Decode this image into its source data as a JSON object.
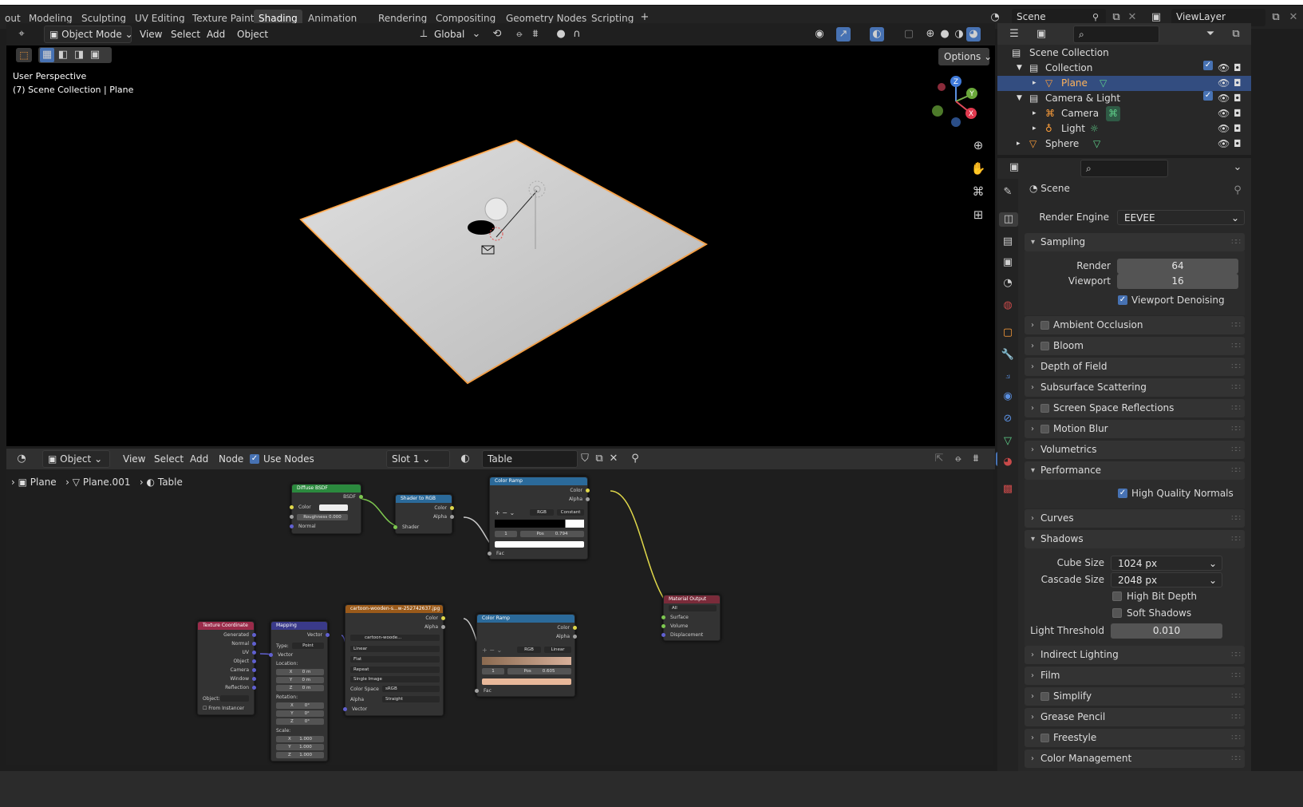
{
  "workspace_tabs": [
    "out",
    "Modeling",
    "Sculpting",
    "UV Editing",
    "Texture Paint",
    "Shading",
    "Animation",
    "Rendering",
    "Compositing",
    "Geometry Nodes",
    "Scripting"
  ],
  "active_tab": "Shading",
  "scene_name": "Scene",
  "view_layer": "ViewLayer",
  "viewport": {
    "mode": "Object Mode",
    "menus": [
      "View",
      "Select",
      "Add",
      "Object"
    ],
    "transform_orientation": "Global",
    "options_label": "Options",
    "overlay_line1": "User Perspective",
    "overlay_line2": "(7) Scene Collection | Plane",
    "gizmo_axes": {
      "z": "Z",
      "y": "Y",
      "x": "X"
    }
  },
  "node_editor": {
    "editor_type": "Object",
    "menus": [
      "View",
      "Select",
      "Add",
      "Node"
    ],
    "use_nodes_label": "Use Nodes",
    "slot": "Slot 1",
    "material": "Table",
    "breadcrumb": [
      "Plane",
      "Plane.001",
      "Table"
    ],
    "nodes": {
      "diffuse": {
        "title": "Diffuse BSDF",
        "out": "BSDF",
        "color": "Color",
        "roughness": "Roughness",
        "roughness_val": "0.000",
        "normal": "Normal"
      },
      "shader_rgb": {
        "title": "Shader to RGB",
        "color": "Color",
        "alpha": "Alpha",
        "shader": "Shader"
      },
      "ramp1": {
        "title": "Color Ramp",
        "color": "Color",
        "alpha": "Alpha",
        "mode": "RGB",
        "interp": "Constant",
        "idx": "1",
        "pos_label": "Pos",
        "pos": "0.794",
        "fac": "Fac"
      },
      "ramp2": {
        "title": "Color Ramp",
        "color": "Color",
        "alpha": "Alpha",
        "mode": "RGB",
        "interp": "Linear",
        "idx": "1",
        "pos_label": "Pos",
        "pos": "0.605",
        "fac": "Fac"
      },
      "output": {
        "title": "Material Output",
        "target": "All",
        "surface": "Surface",
        "volume": "Volume",
        "displacement": "Displacement"
      },
      "texcoord": {
        "title": "Texture Coordinate",
        "outs": [
          "Generated",
          "Normal",
          "UV",
          "Object",
          "Camera",
          "Window",
          "Reflection"
        ],
        "object_label": "Object:",
        "from_instancer": "From Instancer"
      },
      "mapping": {
        "title": "Mapping",
        "vector_out": "Vector",
        "type_label": "Type:",
        "type": "Point",
        "vector_in": "Vector",
        "location": "Location:",
        "rotation": "Rotation:",
        "scale": "Scale:",
        "loc": [
          "0 m",
          "0 m",
          "0 m"
        ],
        "rot": [
          "0°",
          "0°",
          "0°"
        ],
        "scl": [
          "1.000",
          "1.000",
          "1.000"
        ],
        "axes": [
          "X",
          "Y",
          "Z"
        ]
      },
      "image": {
        "title": "cartoon-wooden-s...w-252742637.jpg",
        "color": "Color",
        "alpha": "Alpha",
        "file": "cartoon-woode...",
        "interp": "Linear",
        "proj": "Flat",
        "ext": "Repeat",
        "src": "Single Image",
        "cs_label": "Color Space",
        "cs": "sRGB",
        "alpha_label": "Alpha",
        "alpha_mode": "Straight",
        "vector": "Vector"
      }
    }
  },
  "outliner": {
    "rows": [
      {
        "label": "Scene Collection",
        "indent": 0
      },
      {
        "label": "Collection",
        "indent": 1
      },
      {
        "label": "Plane",
        "indent": 2,
        "selected": true
      },
      {
        "label": "Camera & Light",
        "indent": 1
      },
      {
        "label": "Camera",
        "indent": 2
      },
      {
        "label": "Light",
        "indent": 2
      },
      {
        "label": "Sphere",
        "indent": 1
      }
    ]
  },
  "properties": {
    "context": "Scene",
    "render_engine_label": "Render Engine",
    "render_engine": "EEVEE",
    "sampling": {
      "title": "Sampling",
      "render_label": "Render",
      "render": "64",
      "viewport_label": "Viewport",
      "viewport": "16",
      "denoise": "Viewport Denoising"
    },
    "panels": [
      "Ambient Occlusion",
      "Bloom",
      "Depth of Field",
      "Subsurface Scattering",
      "Screen Space Reflections",
      "Motion Blur",
      "Volumetrics",
      "Performance"
    ],
    "high_quality_normals": "High Quality Normals",
    "panels2": [
      "Curves",
      "Shadows"
    ],
    "shadows": {
      "cube_label": "Cube Size",
      "cube": "1024 px",
      "cascade_label": "Cascade Size",
      "cascade": "2048 px",
      "hbd": "High Bit Depth",
      "soft": "Soft Shadows",
      "thresh_label": "Light Threshold",
      "thresh": "0.010"
    },
    "panels3": [
      "Indirect Lighting",
      "Film",
      "Simplify",
      "Grease Pencil",
      "Freestyle",
      "Color Management"
    ]
  },
  "colors": {
    "accent": "#4772b3",
    "selected_row": "#334d80",
    "object_orange": "#ff9f3a"
  }
}
